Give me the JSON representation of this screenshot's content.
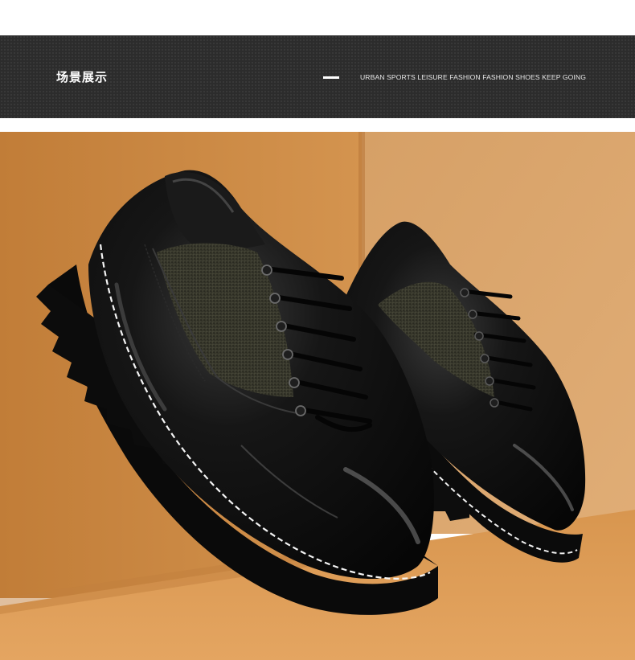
{
  "banner": {
    "title": "场景展示",
    "subtitle": "URBAN SPORTS LEISURE FASHION FASHION SHOES KEEP GOING"
  },
  "scene": {
    "image": "product-scene-photo",
    "wall_color": "#c88a45",
    "floor_color": "#d99a52",
    "shoe_color": "#111111"
  }
}
